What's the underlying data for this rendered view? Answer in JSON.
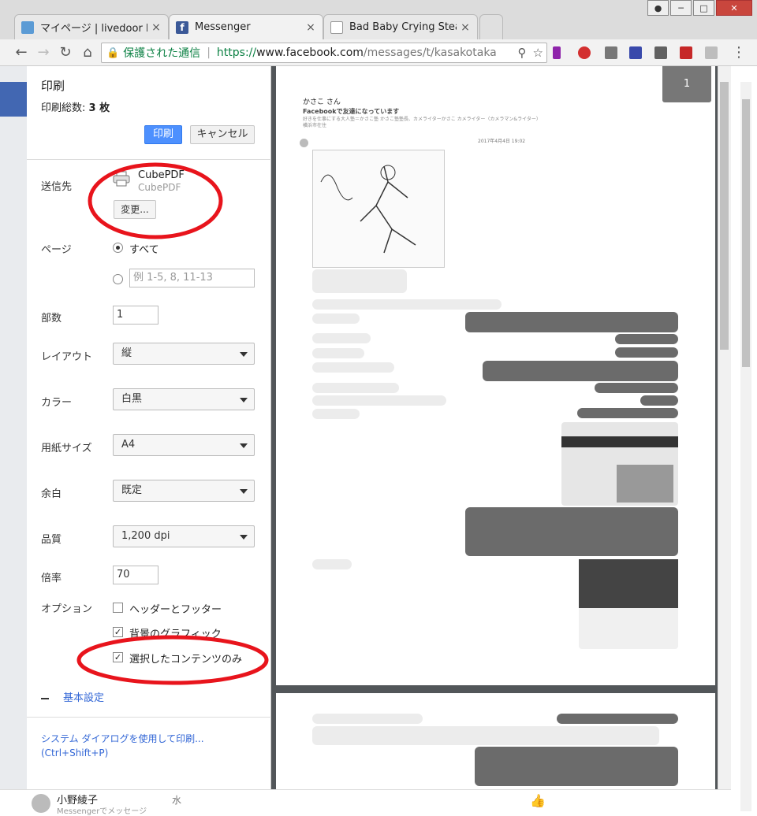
{
  "window": {
    "tabs": [
      {
        "label": "マイページ | livedoor B",
        "icon": "livedoor-icon",
        "color": "#5b9bd5"
      },
      {
        "label": "Messenger",
        "icon": "facebook-icon",
        "color": "#3b5998"
      },
      {
        "label": "Bad Baby Crying Steal",
        "icon": "image-tab-icon",
        "color": "#999999"
      }
    ],
    "close_glyph": "×"
  },
  "address_bar": {
    "secure_label": "保護された通信",
    "separator": "|",
    "url_scheme": "https://",
    "url_host": "www.facebook.com",
    "url_path": "/messages/t/kasakotaka"
  },
  "print": {
    "title": "印刷",
    "sheets_label": "印刷総数:",
    "sheets_value": "3 枚",
    "print_button": "印刷",
    "cancel_button": "キャンセル",
    "destination": {
      "label": "送信先",
      "printer_name": "CubePDF",
      "printer_sub": "CubePDF",
      "change_button": "変更..."
    },
    "pages": {
      "label": "ページ",
      "all": "すべて",
      "range_placeholder": "例 1-5, 8, 11-13"
    },
    "copies": {
      "label": "部数",
      "value": "1"
    },
    "layout": {
      "label": "レイアウト",
      "value": "縦"
    },
    "color": {
      "label": "カラー",
      "value": "白黒"
    },
    "paper_size": {
      "label": "用紙サイズ",
      "value": "A4"
    },
    "margins": {
      "label": "余白",
      "value": "既定"
    },
    "quality": {
      "label": "品質",
      "value": "1,200 dpi"
    },
    "scale": {
      "label": "倍率",
      "value": "70"
    },
    "options": {
      "label": "オプション",
      "headers_footers": "ヘッダーとフッター",
      "background_graphics": "背景のグラフィック",
      "selection_only": "選択したコンテンツのみ"
    },
    "basic_settings": "基本設定",
    "system_dialog": "システム ダイアログを使用して印刷...",
    "system_dialog_shortcut": "(Ctrl+Shift+P)"
  },
  "preview": {
    "page_number": "1",
    "contact_name": "かさこ さん",
    "friend_status": "Facebookで友達になっています",
    "profile_line": "好きを仕事にする大人塾＝かさこ塾 かさこ塾塾長、カメライターかさこ カメライター（カメラマン&ライター）",
    "location": "横浜市在住",
    "date_stamp": "2017年4月4日 19:02"
  },
  "bottom": {
    "contact_name": "小野綾子",
    "day": "水",
    "subtitle": "Messengerでメッセージ"
  },
  "colors": {
    "annotation_red": "#e8141c",
    "print_blue": "#4d90fe",
    "facebook_blue": "#4267b2"
  }
}
